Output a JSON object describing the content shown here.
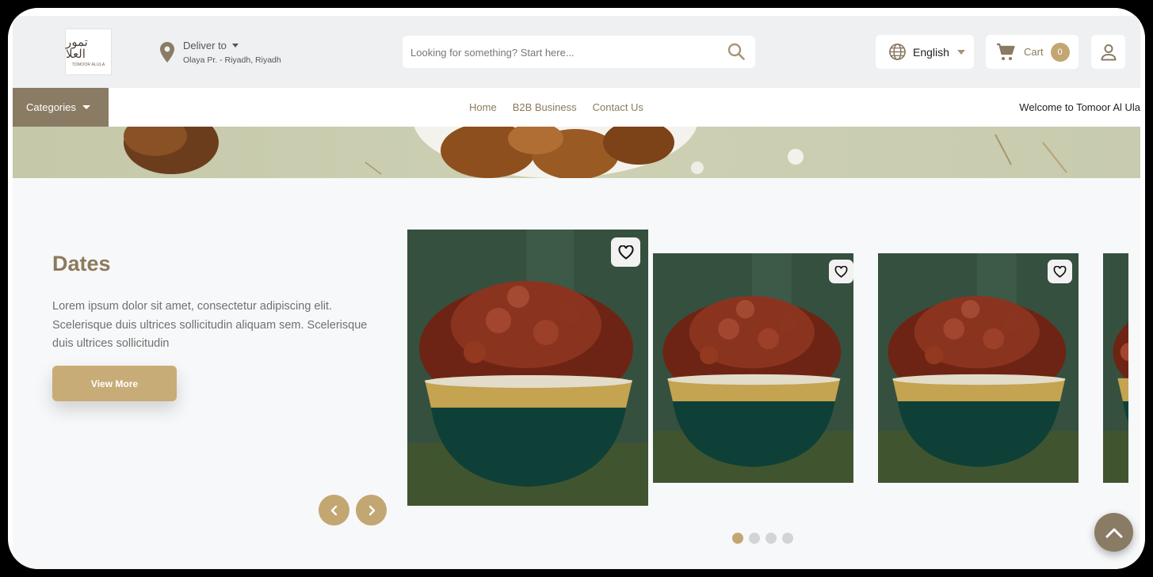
{
  "header": {
    "logo": {
      "arabic_text": "تمور العلا",
      "english_text": "TOMOOR ALULA"
    },
    "deliver": {
      "label": "Deliver to",
      "address": "Olaya Pr. - Riyadh, Riyadh"
    },
    "search": {
      "placeholder": "Looking for something? Start here..."
    },
    "language": {
      "label": "English"
    },
    "cart": {
      "label": "Cart",
      "count": "0"
    }
  },
  "nav": {
    "categories_label": "Categories",
    "links": [
      "Home",
      "B2B Business",
      "Contact Us"
    ],
    "welcome": "Welcome to Tomoor Al Ula"
  },
  "promo": {
    "title": "Dates",
    "description": "Lorem ipsum dolor sit amet, consectetur adipiscing elit. Scelerisque duis ultrices sollicitudin aliquam sem. Scelerisque duis ultrices sollicitudin",
    "button": "View More"
  },
  "carousel": {
    "slide_count": 4,
    "active_index": 0
  },
  "colors": {
    "accent": "#c2a772",
    "dark_accent": "#8a7b64",
    "text_brand": "#8c7a5b"
  },
  "icons": [
    "location-pin-icon",
    "search-icon",
    "globe-icon",
    "cart-icon",
    "user-icon",
    "heart-icon",
    "chevron-left-icon",
    "chevron-right-icon",
    "chevron-up-icon"
  ]
}
